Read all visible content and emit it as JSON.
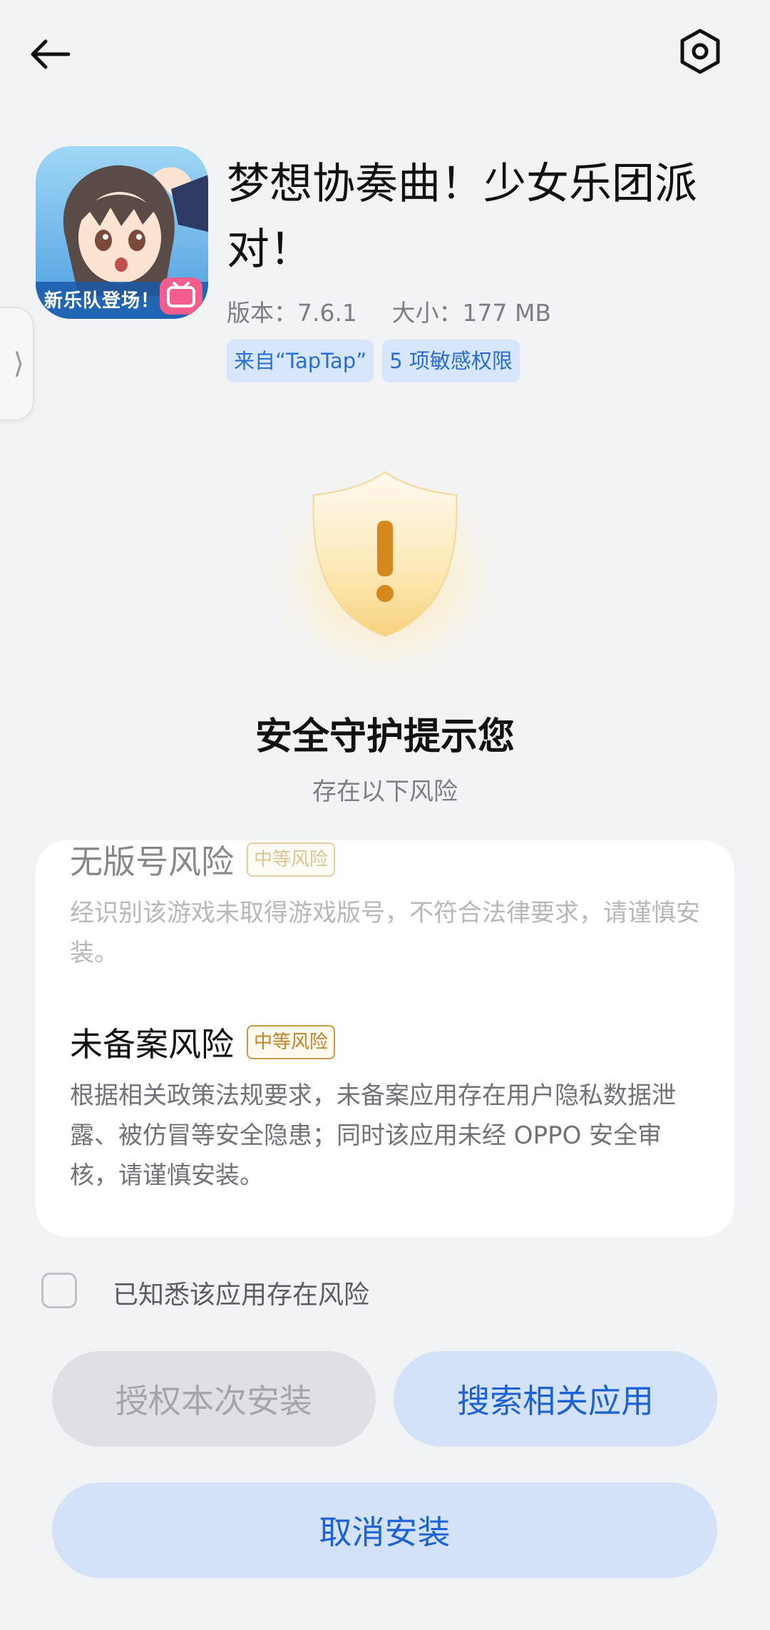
{
  "header": {
    "back_icon": "arrow-left-icon",
    "settings_icon": "hexagon-gear-icon"
  },
  "app": {
    "name": "梦想协奏曲！少女乐团派对！",
    "version": "版本：7.6.1",
    "size": "大小：177 MB",
    "source_chip": "来自“TapTap”",
    "permissions_chip": "5 项敏感权限",
    "icon_banner": "新乐队登场！"
  },
  "warning": {
    "icon": "shield-exclamation-icon",
    "title": "安全守护提示您",
    "subtitle": "存在以下风险"
  },
  "risks": [
    {
      "title": "无版号风险",
      "level": "中等风险",
      "description": "经识别该游戏未取得游戏版号，不符合法律要求，请谨慎安装。"
    },
    {
      "title": "未备案风险",
      "level": "中等风险",
      "description": "根据相关政策法规要求，未备案应用存在用户隐私数据泄露、被仿冒等安全隐患；同时该应用未经 OPPO 安全审核，请谨慎安装。"
    }
  ],
  "acknowledge": {
    "label": "已知悉该应用存在风险",
    "checked": false
  },
  "buttons": {
    "authorize": "授权本次安装",
    "search": "搜索相关应用",
    "cancel": "取消安装"
  },
  "colors": {
    "accent": "#1d62d4",
    "chip_bg": "#d7e6fa",
    "risk_badge": "#b9852b",
    "background": "#f2f3f5"
  }
}
